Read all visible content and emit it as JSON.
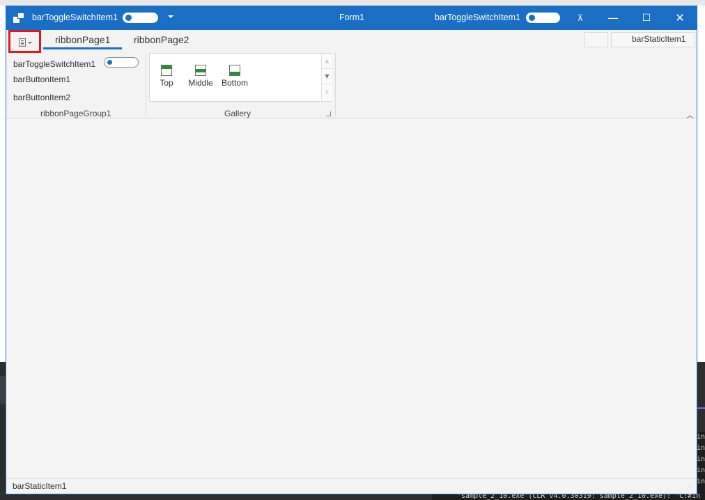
{
  "titlebar": {
    "qat_toggle_label": "barToggleSwitchItem1",
    "form_title": "Form1",
    "right_toggle_label": "barToggleSwitchItem1"
  },
  "ribbon": {
    "tabs": [
      {
        "label": "ribbonPage1",
        "selected": true
      },
      {
        "label": "ribbonPage2",
        "selected": false
      }
    ],
    "header_static": "barStaticItem1",
    "group1": {
      "items": [
        "barToggleSwitchItem1",
        "barButtonItem1",
        "barButtonItem2"
      ],
      "caption": "ribbonPageGroup1"
    },
    "gallery": {
      "items": [
        {
          "label": "Top",
          "icon": "align-top-icon"
        },
        {
          "label": "Middle",
          "icon": "align-middle-icon"
        },
        {
          "label": "Bottom",
          "icon": "align-bottom-icon"
        }
      ],
      "caption": "Gallery"
    }
  },
  "statusbar": {
    "text": "barStaticItem1"
  },
  "background": {
    "output_line": "'sample_2_10.exe'(CLR v4.0.30319: sample_2_10.exe): 'C:#in"
  },
  "colors": {
    "titlebar": "#1a6fc4",
    "highlight_border": "#e3171f",
    "gallery_icon_fill": "#2e8b3a"
  }
}
